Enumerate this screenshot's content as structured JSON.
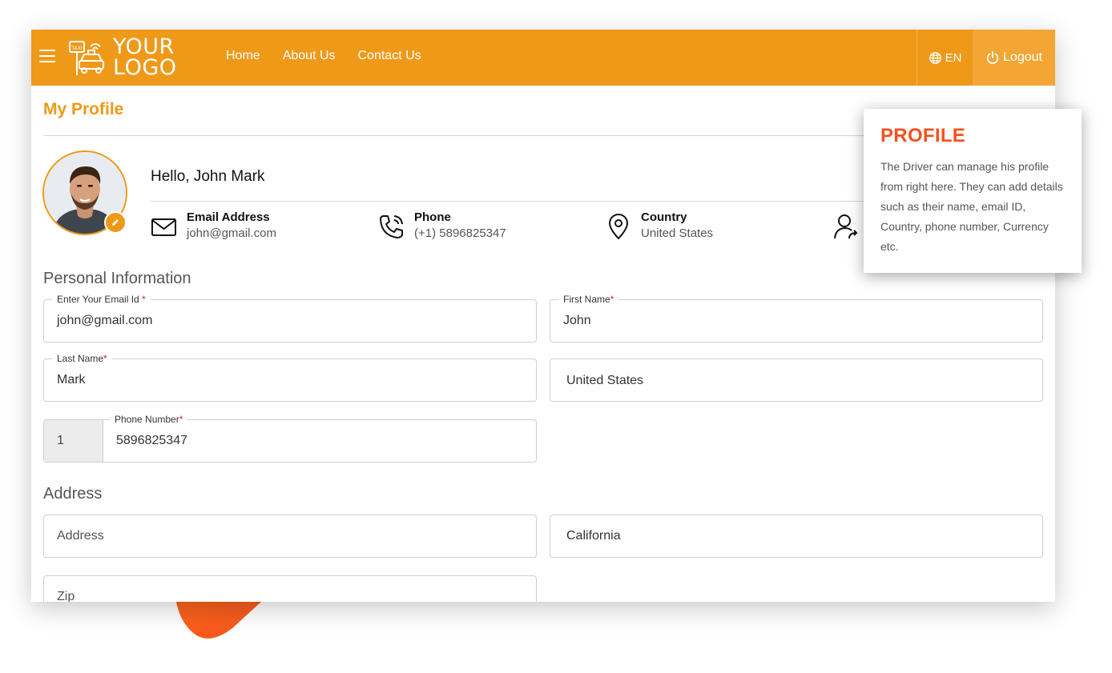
{
  "brand": {
    "logo_line1": "YOUR",
    "logo_line2": "LOGO",
    "logo_badge": "TAXI"
  },
  "nav": {
    "links": [
      "Home",
      "About Us",
      "Contact Us"
    ],
    "language": "EN",
    "logout": "Logout"
  },
  "page": {
    "title": "My Profile",
    "greeting": "Hello, John Mark"
  },
  "contact_info": [
    {
      "label": "Email Address",
      "value": "john@gmail.com",
      "icon": "envelope-icon"
    },
    {
      "label": "Phone",
      "value": "(+1) 5896825347",
      "icon": "phone-icon"
    },
    {
      "label": "Country",
      "value": "United States",
      "icon": "location-pin-icon"
    },
    {
      "label": "",
      "value": "",
      "icon": "user-share-icon"
    }
  ],
  "personal": {
    "heading": "Personal Information",
    "email": {
      "label": "Enter Your Email Id ",
      "required": "*",
      "value": "john@gmail.com"
    },
    "first_name": {
      "label": "First Name",
      "required": "*",
      "value": "John"
    },
    "last_name": {
      "label": "Last Name",
      "required": "*",
      "value": "Mark"
    },
    "country": {
      "value": "United States"
    },
    "phone": {
      "label": "Phone Number",
      "required": "*",
      "code": "1",
      "value": "5896825347"
    }
  },
  "address": {
    "heading": "Address",
    "address_placeholder": "Address",
    "state": "California",
    "zip_placeholder": "Zip"
  },
  "tooltip": {
    "title": "PROFILE",
    "body": "The Driver can manage his profile from right here. They can add details such as their name, email ID, Country, phone number, Currency etc."
  },
  "colors": {
    "primary": "#ef9918",
    "accent": "#f4511e",
    "required": "#e02424"
  }
}
